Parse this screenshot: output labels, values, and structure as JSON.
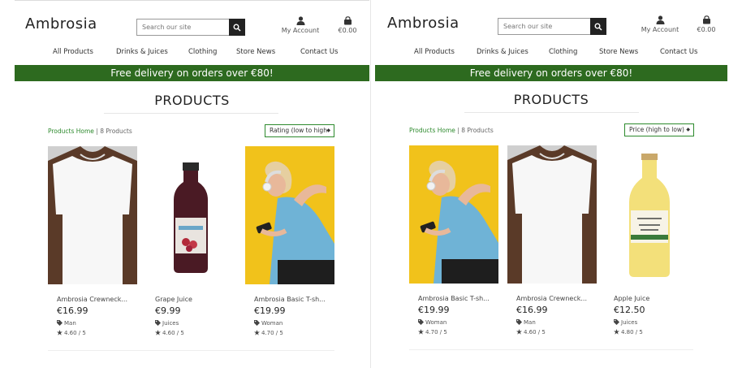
{
  "brand": "Ambrosia",
  "search": {
    "placeholder": "Search our site"
  },
  "account": {
    "label": "My Account"
  },
  "bag": {
    "total": "€0.00"
  },
  "nav": [
    "All Products",
    "Drinks & Juices",
    "Clothing",
    "Store News",
    "Contact Us"
  ],
  "banner": "Free delivery on orders over €80!",
  "heading": "PRODUCTS",
  "breadcrumb": {
    "home": "Products Home",
    "separator": "|",
    "count": "8 Products"
  },
  "colors": {
    "banner_bg": "#2d6a1f",
    "accent": "#2d8a2d"
  },
  "views": [
    {
      "sort_label": "Rating (low to high",
      "products": [
        {
          "name": "Ambrosia Crewneck...",
          "price": "€16.99",
          "category": "Man",
          "rating": "4.60 / 5",
          "image": "white-tshirt"
        },
        {
          "name": "Grape Juice",
          "price": "€9.99",
          "category": "Juices",
          "rating": "4.60 / 5",
          "image": "grape-juice-bottle"
        },
        {
          "name": "Ambrosia Basic T-sh...",
          "price": "€19.99",
          "category": "Woman",
          "rating": "4.70 / 5",
          "image": "woman-headphones"
        }
      ]
    },
    {
      "sort_label": "Price (high to low)",
      "products": [
        {
          "name": "Ambrosia Basic T-sh...",
          "price": "€19.99",
          "category": "Woman",
          "rating": "4.70 / 5",
          "image": "woman-headphones"
        },
        {
          "name": "Ambrosia Crewneck...",
          "price": "€16.99",
          "category": "Man",
          "rating": "4.60 / 5",
          "image": "white-tshirt"
        },
        {
          "name": "Apple Juice",
          "price": "€12.50",
          "category": "Juices",
          "rating": "4.80 / 5",
          "image": "apple-juice-bottle"
        }
      ]
    }
  ]
}
